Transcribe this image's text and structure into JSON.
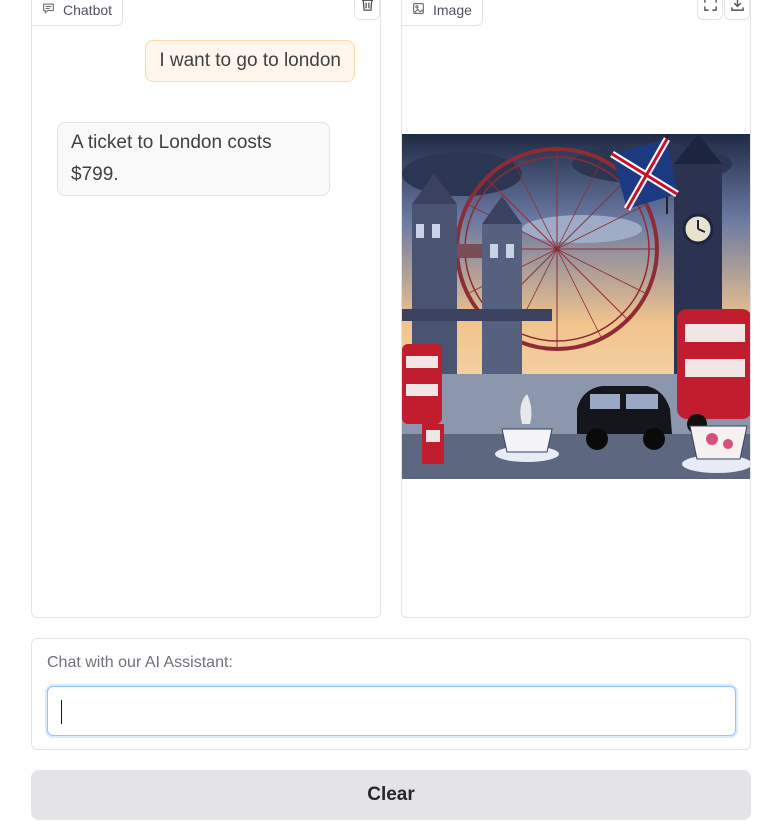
{
  "chatbot": {
    "label": "Chatbot",
    "label_icon": "chat-bubble-icon",
    "clear_icon": "trash-icon",
    "messages": [
      {
        "role": "user",
        "text": "I want to go to london"
      },
      {
        "role": "bot",
        "text": "A ticket to London costs $799."
      }
    ]
  },
  "image_panel": {
    "label": "Image",
    "label_icon": "image-icon",
    "fullscreen_icon": "fullscreen-icon",
    "download_icon": "download-icon"
  },
  "input": {
    "label": "Chat with our AI Assistant:",
    "value": "",
    "placeholder": ""
  },
  "actions": {
    "clear_label": "Clear"
  },
  "colors": {
    "user_bubble_bg": "#fff7ed",
    "user_bubble_border": "#fed7aa",
    "bot_bubble_bg": "#f9f9fa",
    "focus_border": "#93c5fd",
    "button_bg": "#e4e4e7"
  }
}
